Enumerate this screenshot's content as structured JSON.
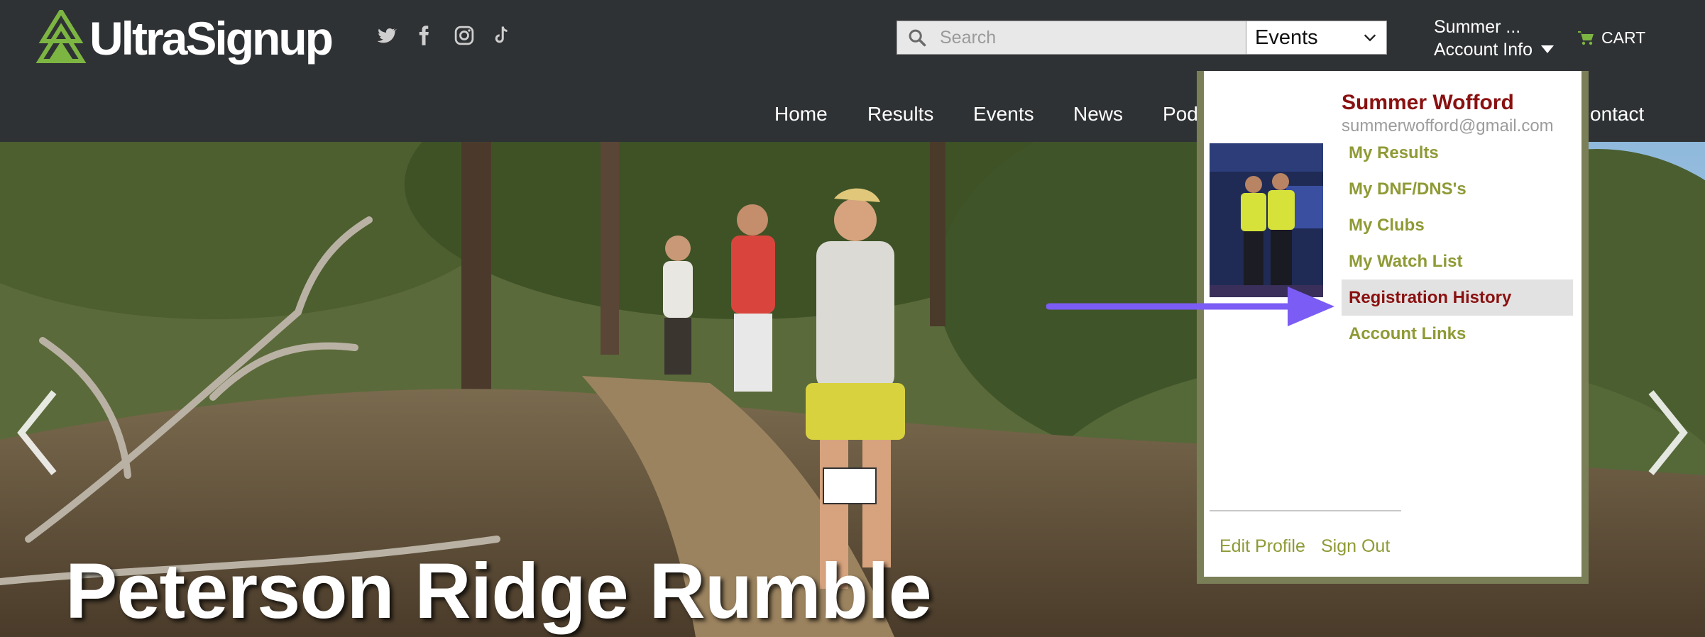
{
  "header": {
    "logo_text": "UltraSignup",
    "search": {
      "placeholder": "Search",
      "value": ""
    },
    "search_category": "Events",
    "account": {
      "name": "Summer ...",
      "label": "Account Info"
    },
    "cart_label": "CART"
  },
  "social_icons": [
    "twitter-icon",
    "facebook-icon",
    "instagram-icon",
    "tiktok-icon"
  ],
  "nav": {
    "items": [
      {
        "label": "Home"
      },
      {
        "label": "Results"
      },
      {
        "label": "Events"
      },
      {
        "label": "News"
      },
      {
        "label": "Pod"
      },
      {
        "label": "ontact"
      }
    ]
  },
  "hero": {
    "title": "Peterson Ridge Rumble",
    "prev_icon": "chevron-left-icon",
    "next_icon": "chevron-right-icon"
  },
  "account_menu": {
    "name": "Summer Wofford",
    "email": "summerwofford@gmail.com",
    "items": [
      {
        "label": "My Results"
      },
      {
        "label": "My DNF/DNS's"
      },
      {
        "label": "My Clubs"
      },
      {
        "label": "My Watch List"
      },
      {
        "label": "Registration History",
        "active": true
      },
      {
        "label": "Account Links"
      }
    ],
    "edit_profile": "Edit Profile",
    "sign_out": "Sign Out"
  },
  "colors": {
    "header_bg": "#2f3234",
    "menu_link": "#8f9a35",
    "menu_active": "#8a1010",
    "annotation_arrow": "#7b5cf5",
    "logo_green": "#7db542"
  }
}
